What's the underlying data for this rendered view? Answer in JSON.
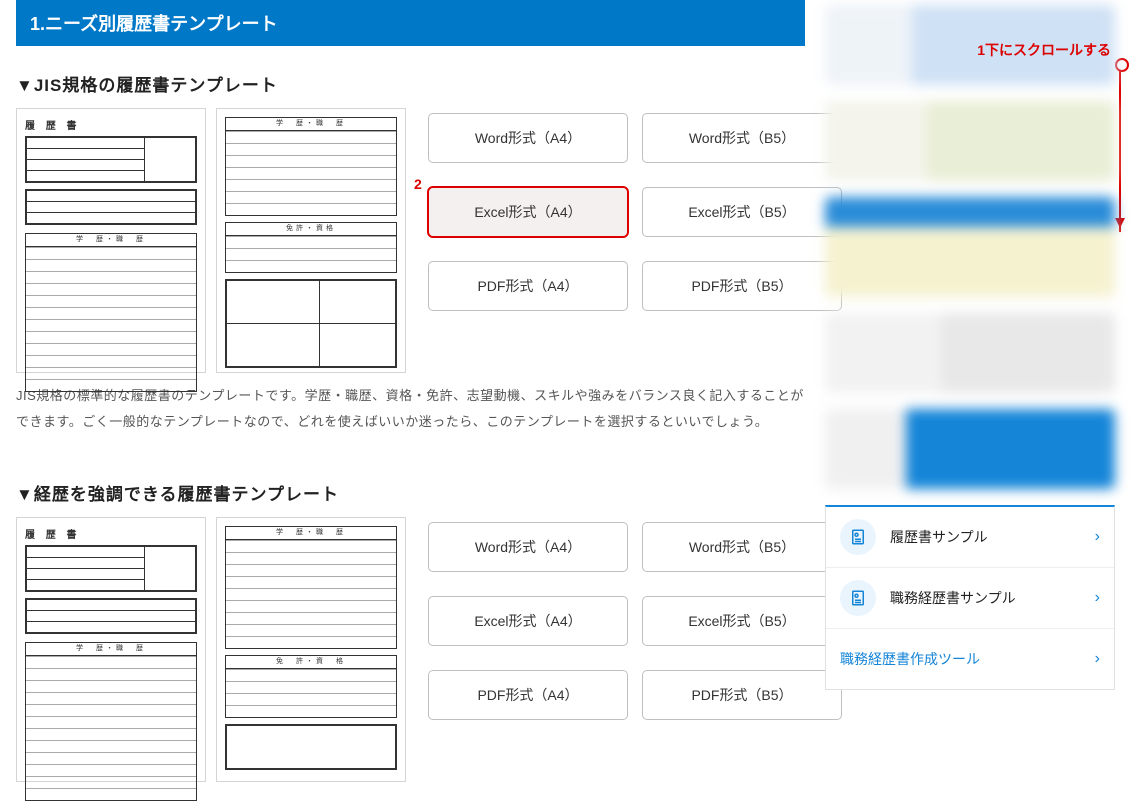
{
  "section_title": "1.ニーズ別履歴書テンプレート",
  "jis": {
    "heading": "▼JIS規格の履歴書テンプレート",
    "buttons": [
      {
        "label": "Word形式（A4）",
        "hl": false
      },
      {
        "label": "Word形式（B5）",
        "hl": false
      },
      {
        "label": "Excel形式（A4）",
        "hl": true
      },
      {
        "label": "Excel形式（B5）",
        "hl": false
      },
      {
        "label": "PDF形式（A4）",
        "hl": false
      },
      {
        "label": "PDF形式（B5）",
        "hl": false
      }
    ],
    "description": "JIS規格の標準的な履歴書のテンプレートです。学歴・職歴、資格・免許、志望動機、スキルや強みをバランス良く記入することができます。ごく一般的なテンプレートなので、どれを使えばいいか迷ったら、このテンプレートを選択するといいでしょう。"
  },
  "keireki": {
    "heading": "▼経歴を強調できる履歴書テンプレート",
    "buttons": [
      {
        "label": "Word形式（A4）"
      },
      {
        "label": "Word形式（B5）"
      },
      {
        "label": "Excel形式（A4）"
      },
      {
        "label": "Excel形式（B5）"
      },
      {
        "label": "PDF形式（A4）"
      },
      {
        "label": "PDF形式（B5）"
      }
    ]
  },
  "sidebar": {
    "items": [
      {
        "label": "履歴書サンプル",
        "icon": true
      },
      {
        "label": "職務経歴書サンプル",
        "icon": true
      },
      {
        "label": "職務経歴書作成ツール",
        "icon": false
      }
    ]
  },
  "annotations": {
    "scroll": "1下にスクロールする",
    "mark2": "2"
  },
  "preview_labels": {
    "title": "履 歴 書"
  }
}
